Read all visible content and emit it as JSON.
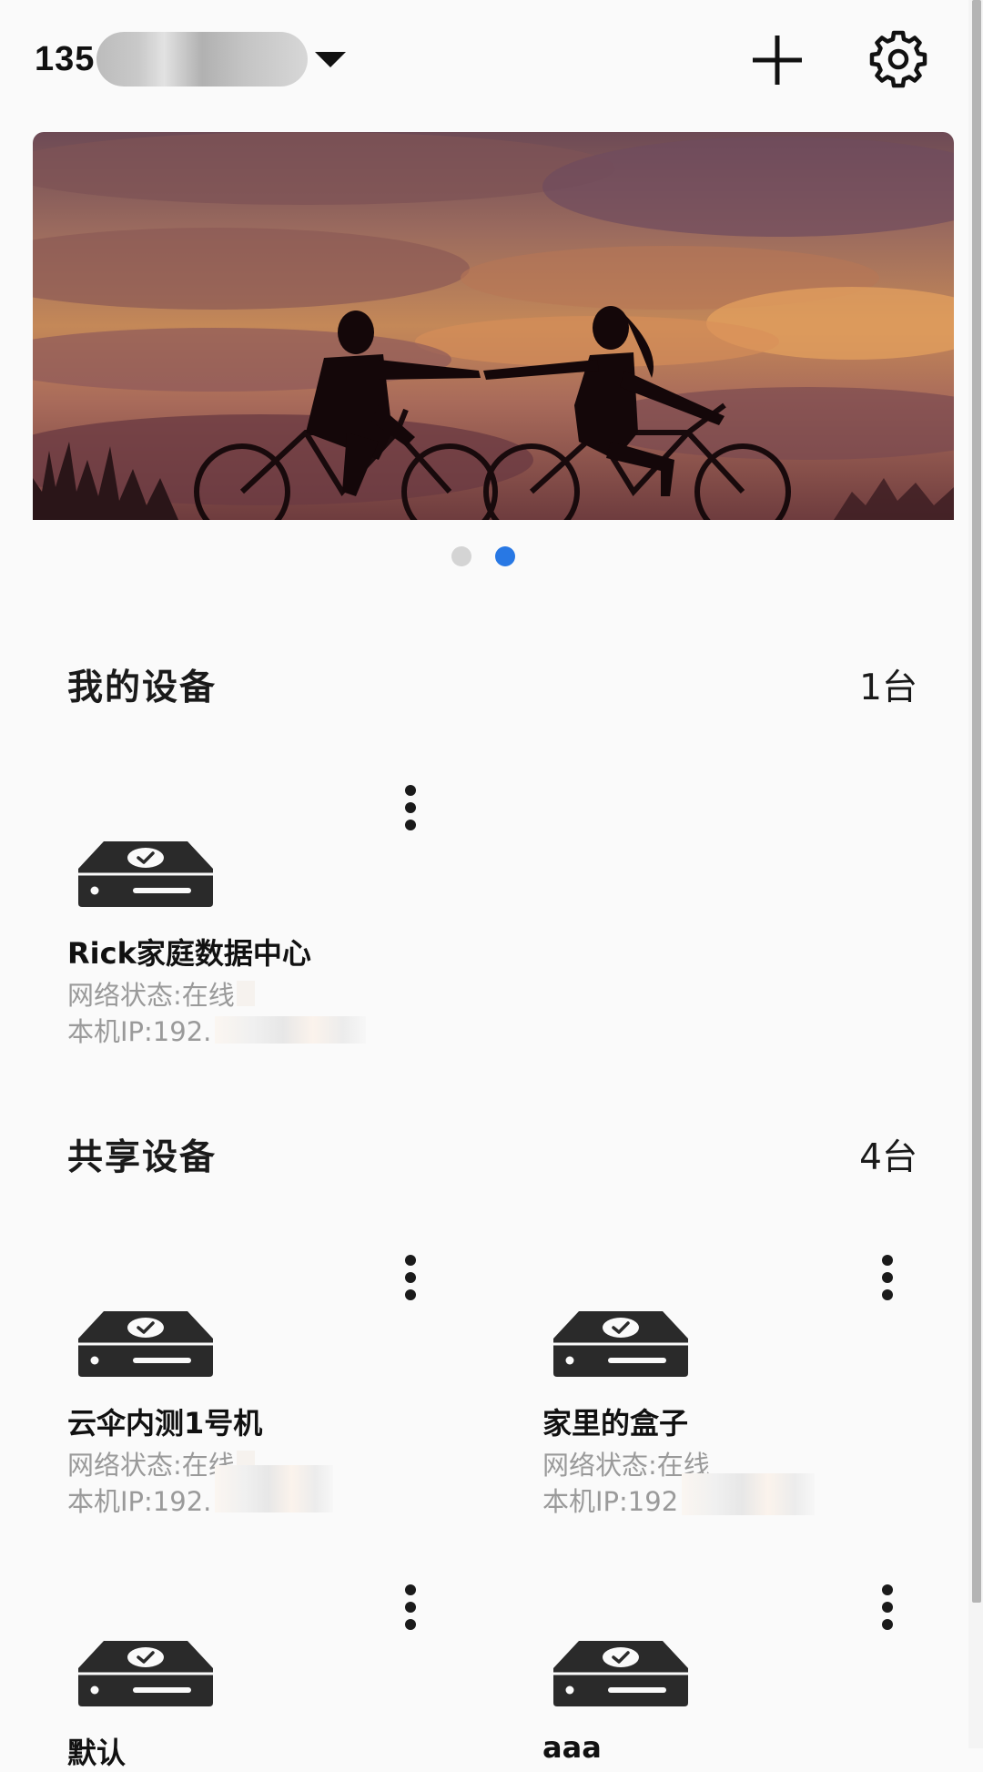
{
  "header": {
    "account_prefix": "135",
    "account_masked": true,
    "add_icon": "plus-icon",
    "settings_icon": "gear-icon"
  },
  "banner": {
    "image": "sunset-couple-bicycles-photo",
    "pages": 2,
    "active_page": 2
  },
  "my_devices": {
    "title": "我的设备",
    "count": "1台",
    "items": [
      {
        "name": "Rick家庭数据中心",
        "status": "网络状态:在线",
        "ip": "本机IP:192.",
        "icon": "server-check-icon"
      }
    ]
  },
  "shared_devices": {
    "title": "共享设备",
    "count": "4台",
    "items": [
      {
        "name": "云伞内测1号机",
        "status": "网络状态:在线",
        "ip": "本机IP:192.",
        "icon": "server-check-icon"
      },
      {
        "name": "家里的盒子",
        "status": "网络状态:在线",
        "ip": "本机IP:192",
        "icon": "server-check-icon"
      },
      {
        "name": "默认",
        "status": "",
        "ip": "",
        "icon": "server-check-icon"
      },
      {
        "name": "aaa",
        "status": "",
        "ip": "",
        "icon": "server-check-icon"
      }
    ]
  },
  "colors": {
    "accent": "#2878e4",
    "text_primary": "#1a1a1a",
    "text_secondary": "#9a9a9a",
    "background": "#fafafa"
  }
}
